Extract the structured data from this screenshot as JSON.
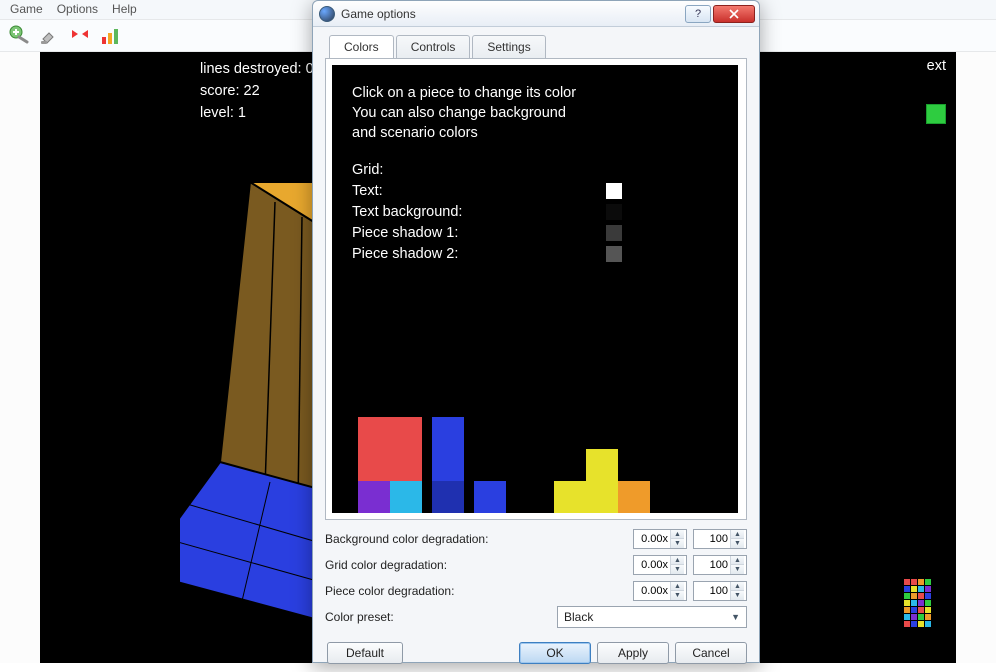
{
  "main_menu": {
    "game": "Game",
    "options": "Options",
    "help": "Help"
  },
  "stats": {
    "lines_label": "lines destroyed:",
    "lines_value": "0",
    "score_label": "score:",
    "score_value": "22",
    "level_label": "level:",
    "level_value": "1",
    "next_label": "ext"
  },
  "dialog": {
    "title": "Game options",
    "tabs": {
      "colors": "Colors",
      "controls": "Controls",
      "settings": "Settings"
    },
    "instruction_l1": "Click on a piece to change its color",
    "instruction_l2": "You can also change background",
    "instruction_l3": "and scenario colors",
    "legend": {
      "grid": "Grid:",
      "text": "Text:",
      "text_bg": "Text background:",
      "shadow1": "Piece shadow 1:",
      "shadow2": "Piece shadow 2:"
    },
    "swatch_colors": {
      "grid": "#000000",
      "text": "#ffffff",
      "text_bg": "#0b0b0b",
      "shadow1": "#3a3a3a",
      "shadow2": "#555555"
    },
    "degradation": {
      "bg_label": "Background color degradation:",
      "grid_label": "Grid color degradation:",
      "piece_label": "Piece color degradation:",
      "bg_x": "0.00x",
      "bg_v": "100",
      "grid_x": "0.00x",
      "grid_v": "100",
      "piece_x": "0.00x",
      "piece_v": "100"
    },
    "preset_label": "Color preset:",
    "preset_value": "Black",
    "buttons": {
      "default": "Default",
      "ok": "OK",
      "apply": "Apply",
      "cancel": "Cancel"
    }
  },
  "piece_colors": {
    "red": "#e84a4a",
    "red_dark": "#c93a3a",
    "blue": "#2a3fe0",
    "blue_dark": "#1f30b0",
    "purple": "#7a2ed1",
    "cyan": "#2bb8e8",
    "yellow": "#e7e22b",
    "orange": "#ef9b2a",
    "green": "#2ecc40"
  }
}
